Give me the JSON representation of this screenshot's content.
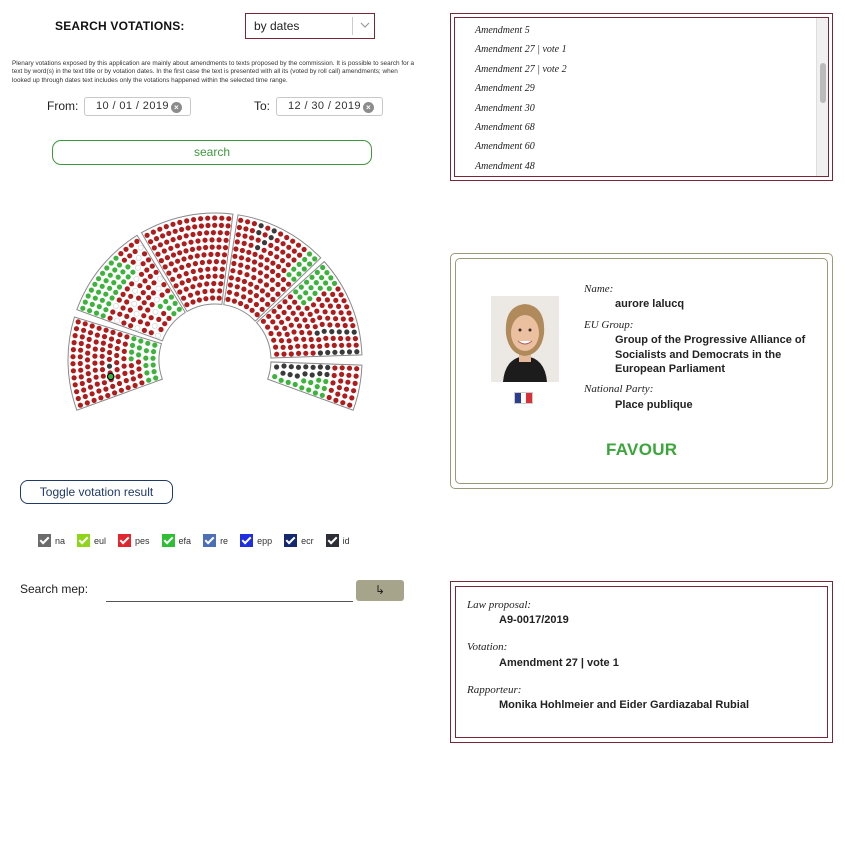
{
  "search": {
    "title": "SEARCH VOTATIONS:",
    "mode": "by dates",
    "intro": "Plenary votations exposed by this application are mainly about amendments to texts proposed by the commission. It is possible to search for a text by word(s) in the text title or by votation dates. In the first case the text is presented with all its (voted by roll call) amendments; when looked up through dates text includes only the votations happened within the selected time range.",
    "from_label": "From:",
    "from_value": "10 / 01 / 2019",
    "to_label": "To:",
    "to_value": "12 / 30 / 2019",
    "button": "search"
  },
  "amendments": [
    "Amendment 5",
    "Amendment 27 | vote 1",
    "Amendment 27 | vote 2",
    "Amendment 29",
    "Amendment 30",
    "Amendment 68",
    "Amendment 60",
    "Amendment 48"
  ],
  "hemicycle": {
    "colors": {
      "red": "#b01c1c",
      "green": "#3cb43c",
      "dark": "#3a3a3a",
      "white": "#ffffff"
    }
  },
  "mep": {
    "name_label": "Name:",
    "name": "aurore lalucq",
    "group_label": "EU Group:",
    "group_lines": [
      "Group of the Progressive Alliance of",
      "Socialists and Democrats in the",
      "European Parliament"
    ],
    "party_label": "National Party:",
    "party": "Place publique",
    "vote": "FAVOUR",
    "flag_colors": [
      "#2a3d8f",
      "#ffffff",
      "#d9303a"
    ]
  },
  "toggle": "Toggle votation result",
  "legend": [
    {
      "key": "na",
      "color": "#6b6b6b"
    },
    {
      "key": "eul",
      "color": "#8fd61a"
    },
    {
      "key": "pes",
      "color": "#e3262d"
    },
    {
      "key": "efa",
      "color": "#2fbf35"
    },
    {
      "key": "re",
      "color": "#4d6fb8"
    },
    {
      "key": "epp",
      "color": "#1f2ee0"
    },
    {
      "key": "ecr",
      "color": "#14286e"
    },
    {
      "key": "id",
      "color": "#2c2f36"
    }
  ],
  "mep_search": {
    "label": "Search mep:",
    "placeholder": "",
    "button": "↳"
  },
  "law": {
    "proposal_label": "Law proposal:",
    "proposal": "A9-0017/2019",
    "votation_label": "Votation:",
    "votation": "Amendment 27 | vote 1",
    "rapporteur_label": "Rapporteur:",
    "rapporteur": "Monika Hohlmeier and Eider Gardiazabal Rubial"
  }
}
